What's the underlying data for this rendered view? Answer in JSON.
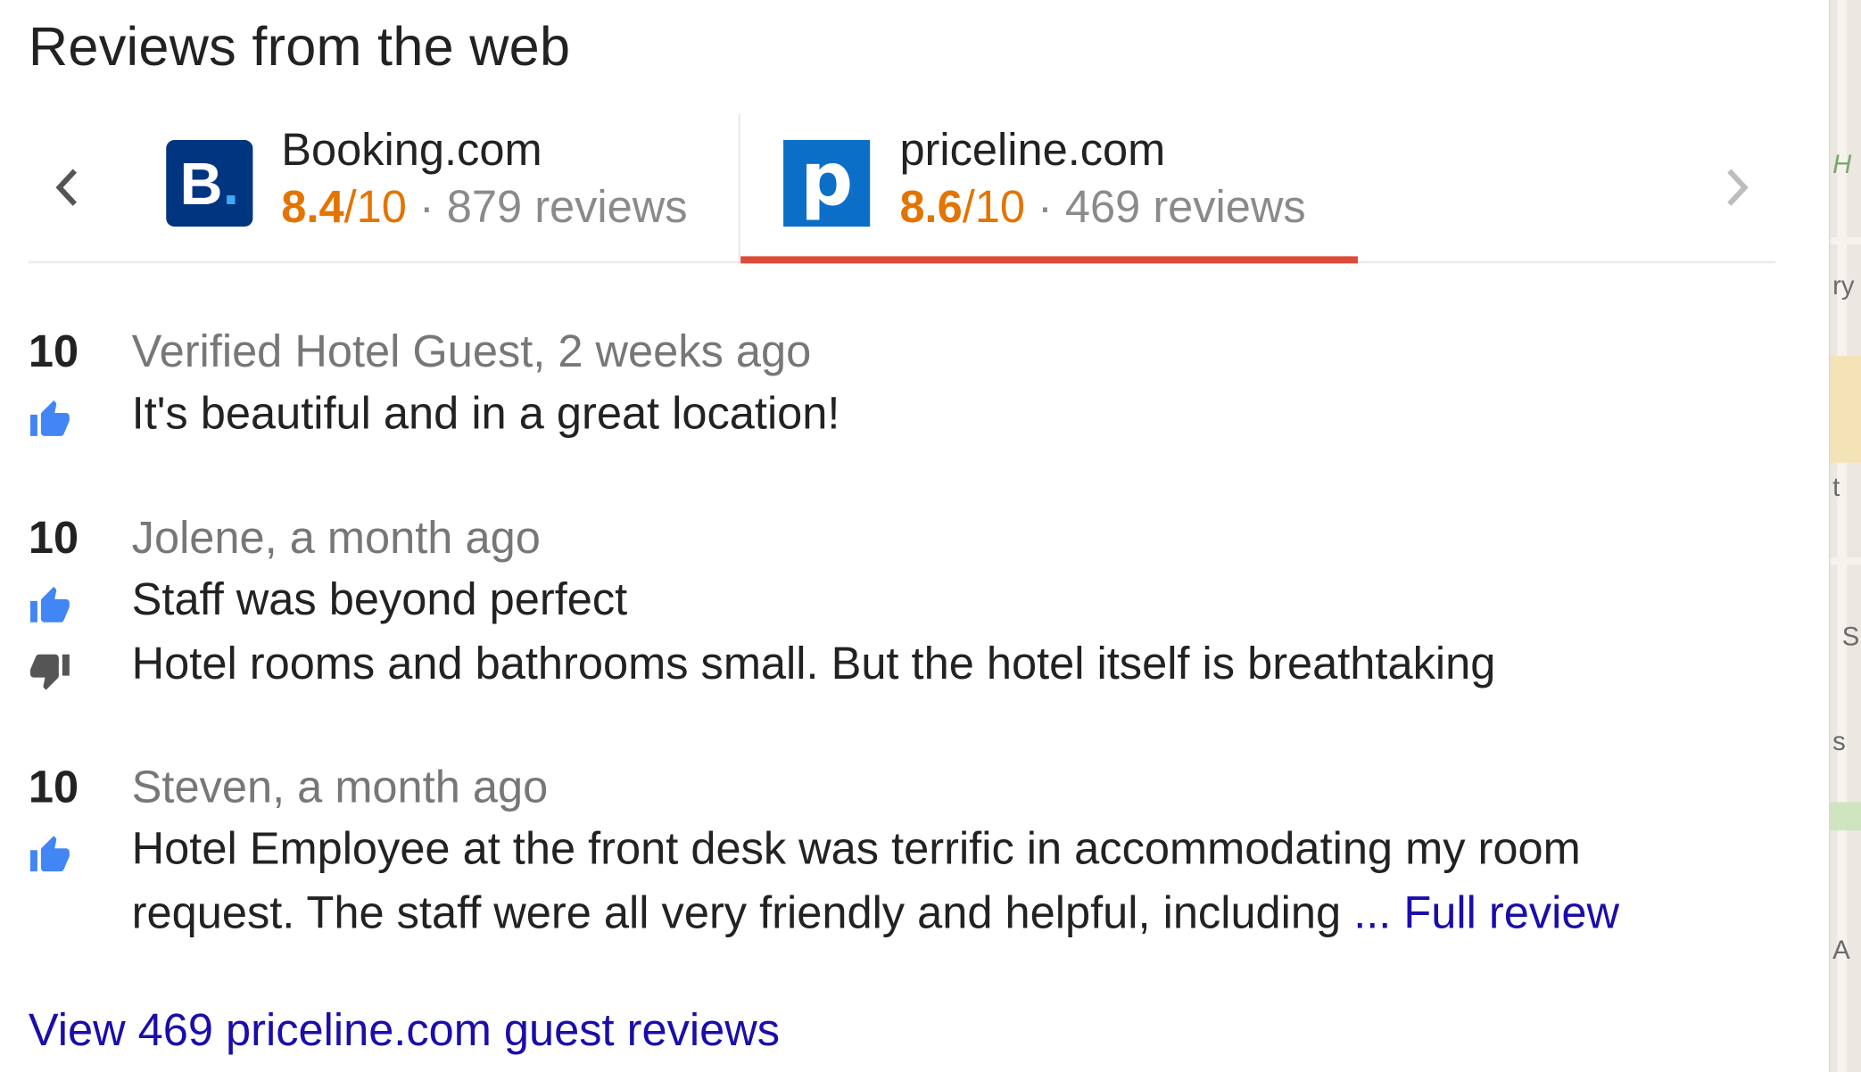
{
  "section": {
    "title": "Reviews from the web"
  },
  "sources": [
    {
      "name": "Booking.com",
      "logo_letter": "B",
      "logo_dot": ".",
      "score": "8.4",
      "score_max": "/10",
      "review_count": " · 879 reviews",
      "logo_color": "#003580",
      "active": false
    },
    {
      "name": "priceline.com",
      "logo_letter": "p",
      "score": "8.6",
      "score_max": "/10",
      "review_count": " · 469 reviews",
      "logo_color": "#0b6ec7",
      "active": true
    }
  ],
  "colors": {
    "score": "#e37400",
    "active_tab_underline": "#dd4b39",
    "link": "#1a0dab",
    "thumb_up": "#4285f4",
    "thumb_down": "#555555"
  },
  "reviews": [
    {
      "score": "10",
      "meta": "Verified Hotel Guest, 2 weeks ago",
      "positive": "It's beautiful and in a great location!"
    },
    {
      "score": "10",
      "meta": "Jolene, a month ago",
      "positive": "Staff was beyond perfect",
      "negative": "Hotel rooms and bathrooms small. But the hotel itself is breathtaking"
    },
    {
      "score": "10",
      "meta": "Steven, a month ago",
      "positive": "Hotel Employee at the front desk was terrific in accommodating my room request. The staff were all very friendly and helpful, including ",
      "more_link": "... Full review"
    }
  ],
  "footer": {
    "view_all": "View 469 priceline.com guest reviews"
  },
  "map_labels": [
    "H",
    "ry",
    "t",
    "S",
    "s",
    "A"
  ]
}
